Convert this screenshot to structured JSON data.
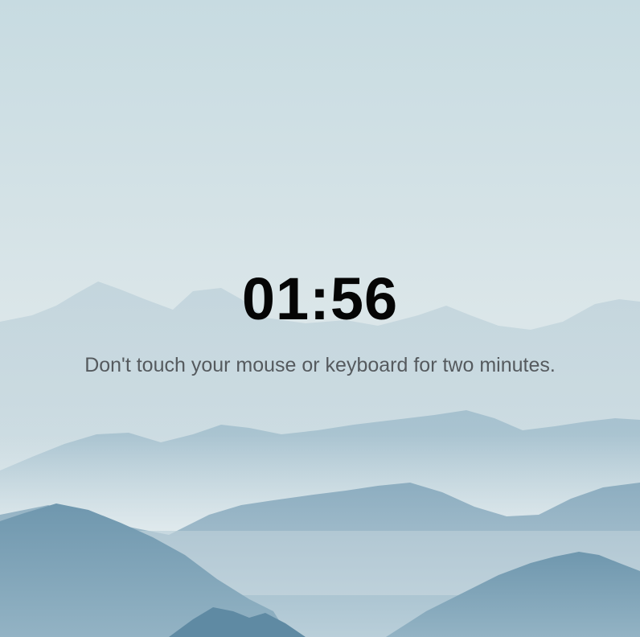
{
  "screen": {
    "timer": "01:56",
    "message": "Don't touch your mouse or keyboard for two minutes."
  },
  "background": {
    "subject": "misty-mountain-range",
    "sky_color": "#d3e2e7",
    "mountain_colors": [
      "#c0d5de",
      "#a9c4d1",
      "#8fb0c2",
      "#7aa0b6",
      "#5f8aa3"
    ]
  }
}
